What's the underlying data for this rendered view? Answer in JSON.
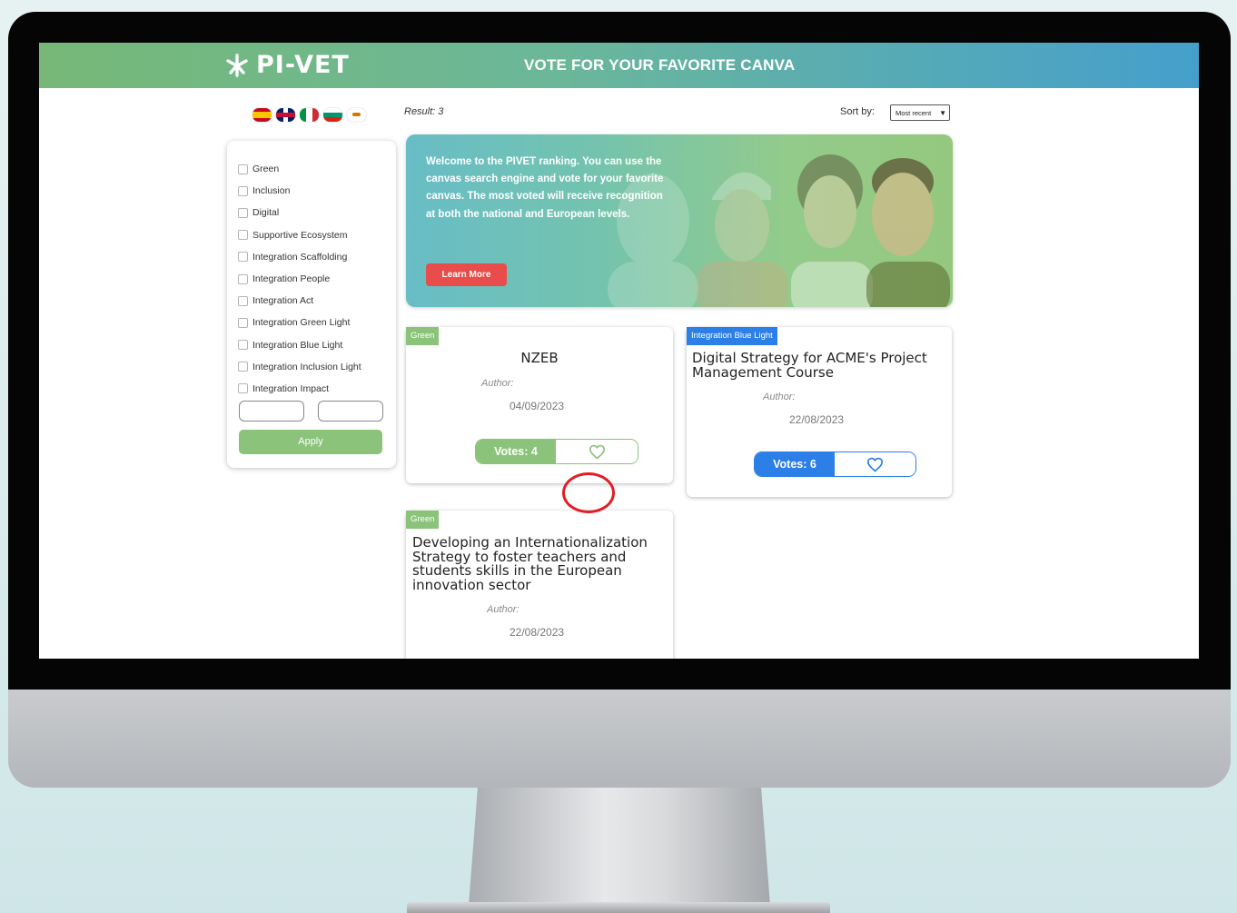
{
  "header": {
    "logo_text": "PI-VET",
    "title": "VOTE FOR YOUR FAVORITE CANVA"
  },
  "languages": [
    "es",
    "en",
    "it",
    "bg",
    "cy"
  ],
  "filters": {
    "items": [
      {
        "label": "Green"
      },
      {
        "label": "Inclusion"
      },
      {
        "label": "Digital"
      },
      {
        "label": "Supportive Ecosystem"
      },
      {
        "label": "Integration Scaffolding"
      },
      {
        "label": "Integration People"
      },
      {
        "label": "Integration Act"
      },
      {
        "label": "Integration Green Light"
      },
      {
        "label": "Integration Blue Light"
      },
      {
        "label": "Integration Inclusion Light"
      },
      {
        "label": "Integration Impact"
      }
    ],
    "date_from": "",
    "date_to": "",
    "apply_label": "Apply"
  },
  "results": {
    "label": "Result: 3",
    "sort_label": "Sort by:",
    "sort_value": "Most recent"
  },
  "banner": {
    "text": "Welcome to the PIVET ranking. You can use the canvas search engine and vote for your favorite canvas. The most voted will receive recognition at both the national and European levels.",
    "button_label": "Learn More"
  },
  "cards": [
    {
      "tag": "Green",
      "title": "NZEB",
      "author_label": "Author:",
      "date": "04/09/2023",
      "votes_label": "Votes: 4",
      "color": "#8cc37a"
    },
    {
      "tag": "Integration Blue Light",
      "title": "Digital Strategy for ACME's Project Management Course",
      "author_label": "Author:",
      "date": "22/08/2023",
      "votes_label": "Votes: 6",
      "color": "#2b7fe7"
    },
    {
      "tag": "Green",
      "title": "Developing an Internationalization Strategy to foster teachers and students skills in the European innovation sector",
      "author_label": "Author:",
      "date": "22/08/2023",
      "color": "#8cc37a"
    }
  ],
  "icons": {
    "logo": "asterisk-logo-icon",
    "vote": "heart-icon",
    "highlight": "red-circle-annotation"
  }
}
